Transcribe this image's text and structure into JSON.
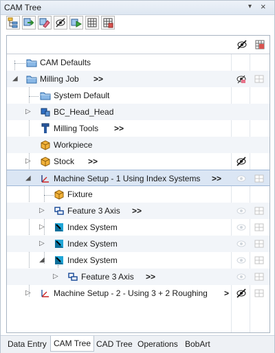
{
  "window": {
    "title": "CAM Tree",
    "pin_glyph": "▾",
    "close_glyph": "×"
  },
  "toolbar": {
    "buttons": [
      {
        "name": "new-tree-icon"
      },
      {
        "name": "import-icon"
      },
      {
        "name": "erase-icon"
      },
      {
        "name": "hide-icon"
      },
      {
        "name": "run-icon"
      },
      {
        "name": "grid-icon"
      },
      {
        "name": "sheet-icon"
      }
    ]
  },
  "tree": {
    "header": {
      "col_visibility_icon": "visibility-off-icon",
      "col_display_icon": "display-grid-icon"
    },
    "items": [
      {
        "label": "CAM Defaults",
        "more": ""
      },
      {
        "label": "Milling Job",
        "more": ">>"
      },
      {
        "label": "System Default",
        "more": ""
      },
      {
        "label": "BC_Head_Head",
        "more": ""
      },
      {
        "label": "Milling Tools",
        "more": ">>"
      },
      {
        "label": "Workpiece",
        "more": ""
      },
      {
        "label": "Stock",
        "more": ">>"
      },
      {
        "label": "Machine Setup - 1 Using Index Systems",
        "more": ">>"
      },
      {
        "label": "Fixture",
        "more": ""
      },
      {
        "label": "Feature 3 Axis",
        "more": ">>"
      },
      {
        "label": "Index System",
        "more": ""
      },
      {
        "label": "Index System",
        "more": ""
      },
      {
        "label": "Index System",
        "more": ""
      },
      {
        "label": "Feature 3 Axis",
        "more": ">>"
      },
      {
        "label": "Machine Setup - 2 - Using 3 + 2 Roughing",
        "more": ">"
      }
    ]
  },
  "tabs": [
    {
      "label": "Data Entry",
      "active": false
    },
    {
      "label": "CAM Tree",
      "active": true
    },
    {
      "label": "CAD Tree",
      "active": false
    },
    {
      "label": "Operations",
      "active": false
    },
    {
      "label": "BobArt",
      "active": false
    }
  ]
}
